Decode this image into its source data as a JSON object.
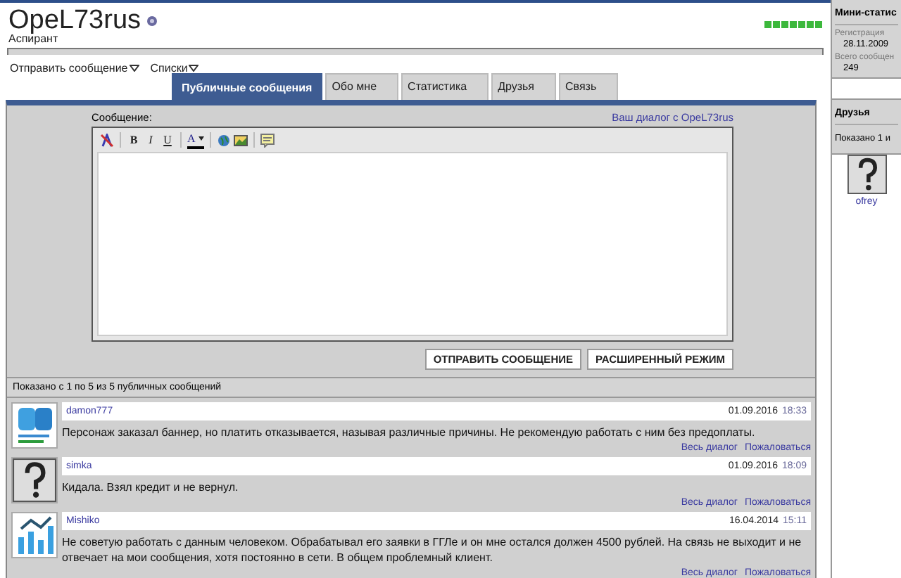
{
  "profile": {
    "username": "OpeL73rus",
    "rank": "Аспирант"
  },
  "actions": [
    {
      "label": "Отправить сообщение"
    },
    {
      "label": "Списки"
    }
  ],
  "tabs": [
    {
      "label": "Публичные сообщения",
      "selected": true
    },
    {
      "label": "Обо мне",
      "selected": false
    },
    {
      "label": "Статистика",
      "selected": false
    },
    {
      "label": "Друзья",
      "selected": false
    },
    {
      "label": "Связь",
      "selected": false
    }
  ],
  "composer": {
    "label": "Сообщение:",
    "dialog_link": "Ваш диалог с OpeL73rus",
    "toolbar": [
      {
        "kind": "clear"
      },
      {
        "kind": "bold",
        "label": "B"
      },
      {
        "kind": "italic",
        "label": "I"
      },
      {
        "kind": "underline",
        "label": "U"
      },
      {
        "kind": "color",
        "label": "A"
      },
      {
        "kind": "link"
      },
      {
        "kind": "image"
      },
      {
        "kind": "quote"
      }
    ],
    "buttons": [
      "ОТПРАВИТЬ СООБЩЕНИЕ",
      "РАСШИРЕННЫЙ РЕЖИМ"
    ]
  },
  "summary": "Показано с 1 по 5 из 5 публичных сообщений",
  "messages": [
    {
      "author": "damon777",
      "date": "01.09.2016",
      "time": "18:33",
      "kind": "logo",
      "text": "Персонаж заказал баннер, но платить отказывается, называя различные причины. Не рекомендую работать с ним без предоплаты.",
      "links": [
        "Весь диалог",
        "Пожаловаться"
      ]
    },
    {
      "author": "simka",
      "date": "01.09.2016",
      "time": "18:09",
      "kind": "unknown",
      "text": "Кидала. Взял кредит и не вернул.",
      "links": [
        "Весь диалог",
        "Пожаловаться"
      ]
    },
    {
      "author": "Mishiko",
      "date": "16.04.2014",
      "time": "15:11",
      "kind": "chart",
      "text": "Не советую работать с данным человеком. Обрабатывал его заявки в ГГЛе и он мне остался должен 4500 рублей. На связь не выходит и не отвечает на мои сообщения, хотя постоянно в сети. В общем проблемный клиент.",
      "links": [
        "Весь диалог",
        "Пожаловаться"
      ]
    }
  ],
  "sidebar": {
    "stats_title": "Мини-статис",
    "stats": [
      {
        "label": "Регистрация",
        "value": "28.11.2009"
      },
      {
        "label": "Всего сообщен",
        "value": "249"
      }
    ],
    "friends_title": "Друзья",
    "friends_count": "Показано 1 и",
    "friends": [
      {
        "name": "ofrey"
      }
    ]
  }
}
